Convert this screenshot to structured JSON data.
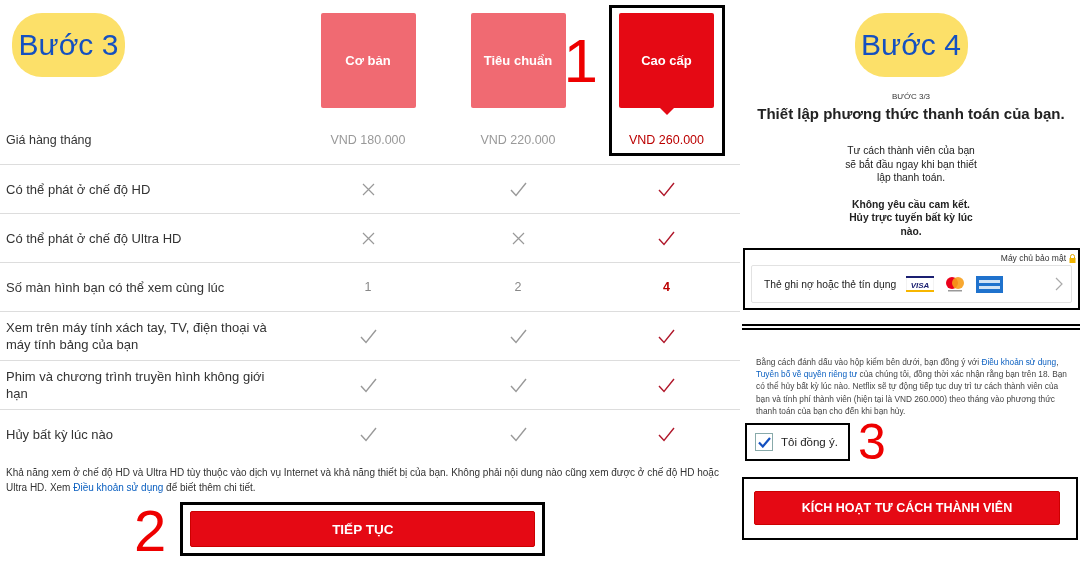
{
  "step3": {
    "badge": "Bước 3",
    "price_label": "Giá hàng tháng",
    "plan_marker": "1",
    "plans": [
      {
        "name": "Cơ bản",
        "price": "VND 180.000",
        "selected": false
      },
      {
        "name": "Tiêu chuẩn",
        "price": "VND 220.000",
        "selected": false
      },
      {
        "name": "Cao cấp",
        "price": "VND 260.000",
        "selected": true
      }
    ],
    "features": [
      {
        "label": "Có thể phát ở chế độ HD",
        "values": [
          {
            "kind": "cross"
          },
          {
            "kind": "check"
          },
          {
            "kind": "check"
          }
        ]
      },
      {
        "label": "Có thể phát ở chế độ Ultra HD",
        "values": [
          {
            "kind": "cross"
          },
          {
            "kind": "cross"
          },
          {
            "kind": "check"
          }
        ]
      },
      {
        "label": "Số màn hình bạn có thể xem cùng lúc",
        "values": [
          {
            "kind": "text",
            "text": "1"
          },
          {
            "kind": "text",
            "text": "2"
          },
          {
            "kind": "text",
            "text": "4"
          }
        ]
      },
      {
        "label": "Xem trên máy tính xách tay, TV, điện thoại và máy tính bảng của bạn",
        "values": [
          {
            "kind": "check"
          },
          {
            "kind": "check"
          },
          {
            "kind": "check"
          }
        ]
      },
      {
        "label": "Phim và chương trình truyền hình không giới hạn",
        "values": [
          {
            "kind": "check"
          },
          {
            "kind": "check"
          },
          {
            "kind": "check"
          }
        ]
      },
      {
        "label": "Hủy bất kỳ lúc nào",
        "values": [
          {
            "kind": "check"
          },
          {
            "kind": "check"
          },
          {
            "kind": "check"
          }
        ]
      }
    ],
    "note": [
      {
        "kind": "text",
        "text": "Khả năng xem ở chế độ HD và Ultra HD tùy thuộc vào dịch vụ Internet và khả năng thiết bị của bạn. Không phải nội dung nào cũng xem được ở chế độ HD hoặc Ultra HD. Xem "
      },
      {
        "kind": "link",
        "text": "Điều khoản sử dụng"
      },
      {
        "kind": "text",
        "text": " để biết thêm chi tiết."
      }
    ],
    "button_marker": "2",
    "button": "TIẾP TỤC"
  },
  "step4": {
    "badge": "Bước 4",
    "step_label": "BƯỚC 3/3",
    "title": "Thiết lập phương thức thanh toán của bạn.",
    "intro": "Tư cách thành viên của bạn sẽ bắt đầu ngay khi bạn thiết lập thanh toán.",
    "commitment": "Không yêu cầu cam kết. Hủy trực tuyến bất kỳ lúc nào.",
    "secure_label": "Máy chủ bảo mật",
    "payment_option": "Thẻ ghi nợ hoặc thẻ tín dụng",
    "visa_label": "VISA",
    "legal": [
      {
        "kind": "text",
        "text": "Bằng cách đánh dấu vào hộp kiểm bên dưới, bạn đồng ý với "
      },
      {
        "kind": "link",
        "text": "Điều khoản sử dụng"
      },
      {
        "kind": "text",
        "text": ", "
      },
      {
        "kind": "link",
        "text": "Tuyên bố về quyền riêng tư"
      },
      {
        "kind": "text",
        "text": " của chúng tôi, đồng thời xác nhận rằng bạn trên 18. Bạn có thể hủy bất kỳ lúc nào. Netflix sẽ tự động tiếp tục duy trì tư cách thành viên của bạn và tính phí thành viên (hiện tại là VND 260.000) theo tháng vào phương thức thanh toán của bạn cho đến khi bạn hủy."
      }
    ],
    "agree": {
      "label": "Tôi đồng ý.",
      "checked": true
    },
    "agree_marker": "3",
    "button": "KÍCH HOẠT TƯ CÁCH THÀNH VIÊN"
  }
}
